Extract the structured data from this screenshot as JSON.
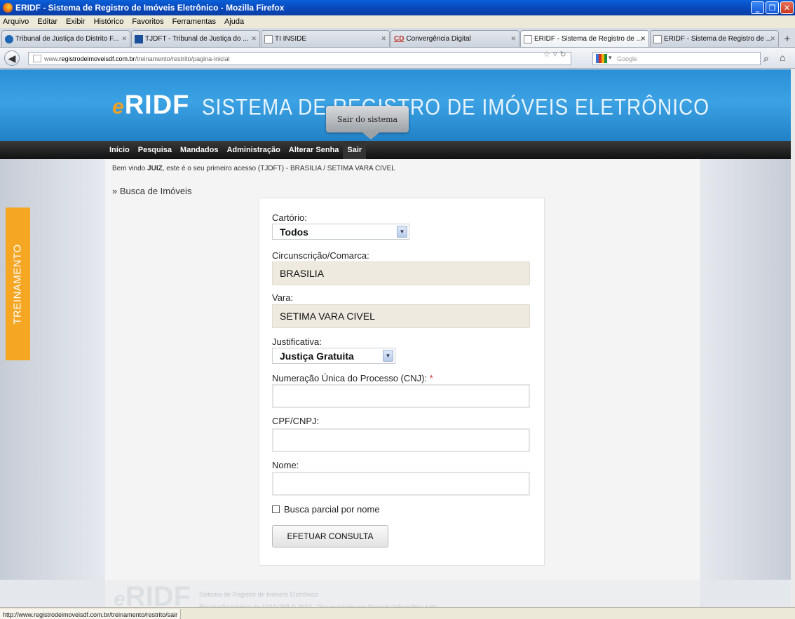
{
  "window": {
    "title": "ERIDF - Sistema de Registro de Imóveis Eletrônico - Mozilla Firefox"
  },
  "menubar": [
    "Arquivo",
    "Editar",
    "Exibir",
    "Histórico",
    "Favoritos",
    "Ferramentas",
    "Ajuda"
  ],
  "tabs": [
    {
      "label": "Tribunal de Justiça do Distrito F..."
    },
    {
      "label": "TJDFT - Tribunal de Justiça do ..."
    },
    {
      "label": "TI INSIDE"
    },
    {
      "label": "Convergência Digital",
      "icon": "CD"
    },
    {
      "label": "ERIDF - Sistema de Registro de ...",
      "active": true
    },
    {
      "label": "ERIDF - Sistema de Registro de ..."
    }
  ],
  "nav": {
    "url_prefix": "www.",
    "url_host": "registrodeimoveisdf.com.br",
    "url_path": "/treinamento/restrito/pagina-inicial",
    "search_placeholder": "Google"
  },
  "banner": {
    "logo_e": "e",
    "logo_rest": "RIDF",
    "title": "SISTEMA DE REGISTRO DE IMÓVEIS ELETRÔNICO",
    "tooltip": "Sair do sistema"
  },
  "sitenav": [
    "Início",
    "Pesquisa",
    "Mandados",
    "Administração",
    "Alterar Senha",
    "Sair"
  ],
  "training_label": "TREINAMENTO",
  "welcome": {
    "pre": "Bem vindo ",
    "user": "JUIZ",
    "post": ", este é o seu primeiro acesso (TJDFT) - BRASILIA / SETIMA VARA CIVEL"
  },
  "section_title": "» Busca de Imóveis",
  "form": {
    "cartorio_label": "Cartório:",
    "cartorio_value": "Todos",
    "circ_label": "Circunscrição/Comarca:",
    "circ_value": "BRASILIA",
    "vara_label": "Vara:",
    "vara_value": "SETIMA VARA CIVEL",
    "just_label": "Justificativa:",
    "just_value": "Justiça Gratuita",
    "cnj_label": "Numeração Única do Processo (CNJ):",
    "cnj_required": "*",
    "cpf_label": "CPF/CNPJ:",
    "nome_label": "Nome:",
    "partial_label": "Busca parcial por nome",
    "submit_label": "EFETUAR CONSULTA"
  },
  "footer": {
    "logo_e": "e",
    "logo_rest": "RIDF",
    "line1": "Sistema de Registro de Imóveis Eletrônico",
    "line2": "Resolução mínima de 1024x768 © 2012 - Desenvolvido por Serenity Informática Ltda"
  },
  "status": "http://www.registrodeimoveisdf.com.br/treinamento/restrito/sair"
}
